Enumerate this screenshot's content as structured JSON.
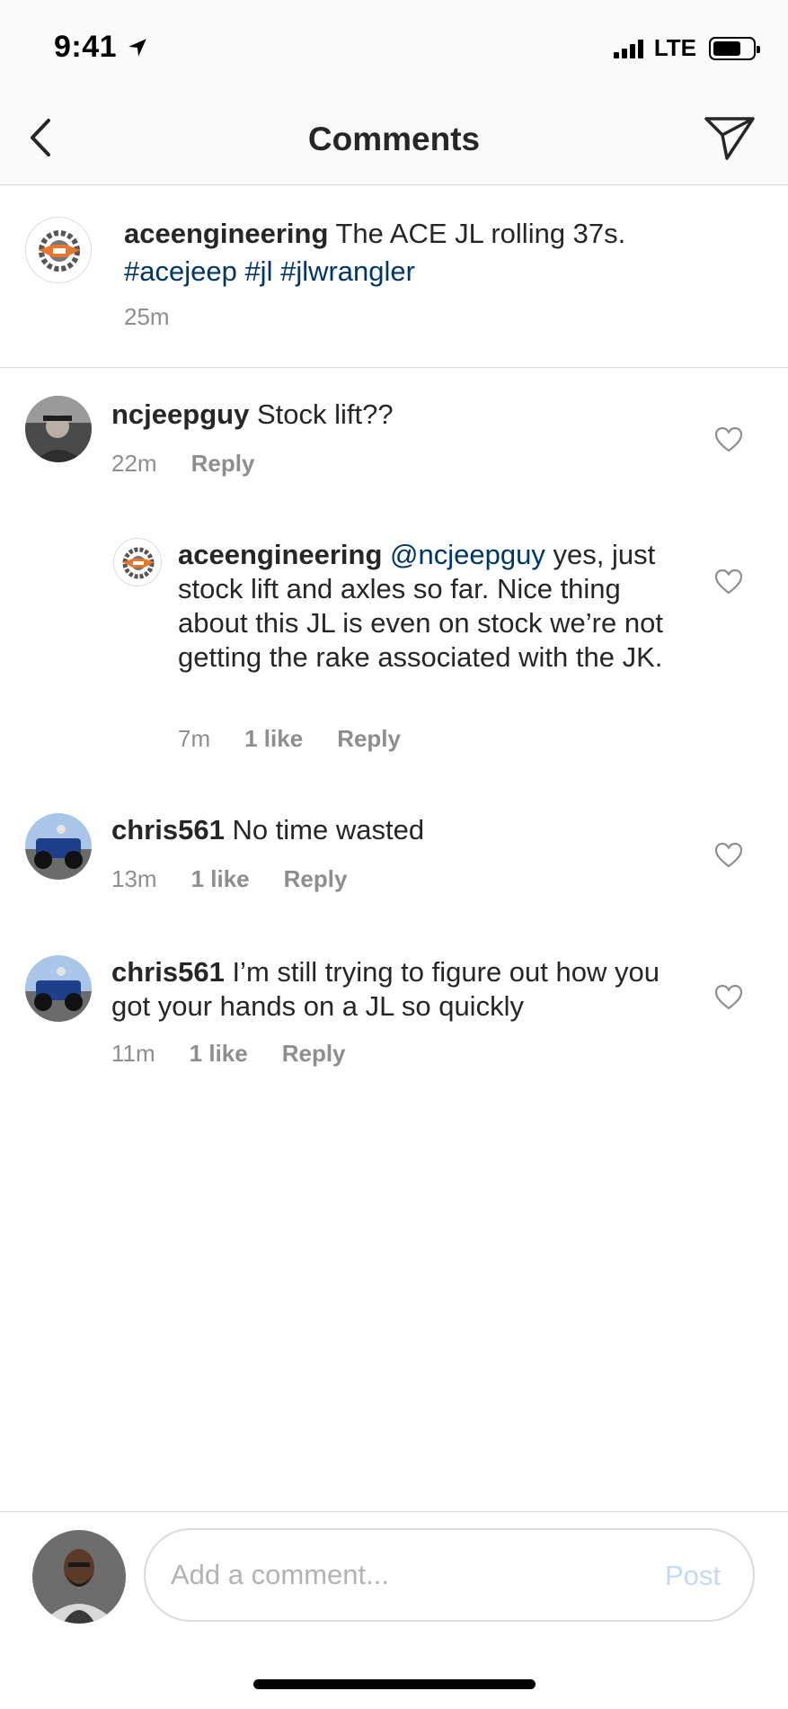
{
  "status_bar": {
    "time": "9:41",
    "carrier": "LTE",
    "battery_level": 0.72
  },
  "header": {
    "title": "Comments",
    "back_icon": "chevron-left-icon",
    "send_icon": "direct-send-icon"
  },
  "caption": {
    "username": "aceengineering",
    "text": " The ACE JL rolling 37s.",
    "hashtags": "#acejeep #jl #jlwrangler",
    "time": "25m"
  },
  "comments": [
    {
      "username": "ncjeepguy",
      "text": " Stock lift??",
      "time": "22m",
      "likes": "",
      "reply_label": "Reply"
    },
    {
      "username": "aceengineering",
      "mention": "@ncjeepguy",
      "text": " yes, just stock lift and axles so far. Nice thing about this JL is even on stock we’re not getting the rake associated with the JK.",
      "time": "7m",
      "likes": "1 like",
      "reply_label": "Reply"
    },
    {
      "username": "chris561",
      "text": " No time wasted",
      "time": "13m",
      "likes": "1 like",
      "reply_label": "Reply"
    },
    {
      "username": "chris561",
      "text": " I’m still trying to figure out how you got your hands on a JL so quickly",
      "time": "11m",
      "likes": "1 like",
      "reply_label": "Reply"
    }
  ],
  "composer": {
    "placeholder": "Add a comment...",
    "post_label": "Post"
  },
  "colors": {
    "hashtag": "#003569",
    "meta": "#8e8e8e",
    "post_disabled": "#c5d9f2",
    "divider": "#dbdbdb"
  }
}
